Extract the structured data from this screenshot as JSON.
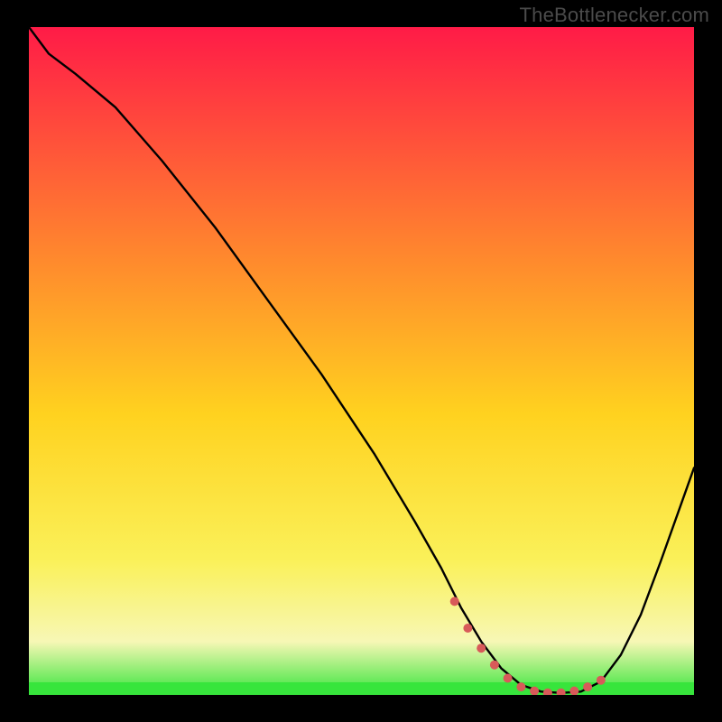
{
  "watermark": "TheBottlenecker.com",
  "colors": {
    "background": "#000000",
    "curve": "#000000",
    "marker": "#d85a59",
    "baseline": "#37e53c",
    "gradient_top": "#ff1b47",
    "gradient_mid_upper": "#ff8a2d",
    "gradient_mid": "#ffd21f",
    "gradient_mid_lower": "#faf15a",
    "gradient_low": "#f7f7b5",
    "gradient_bottom": "#37e53c"
  },
  "chart_data": {
    "type": "line",
    "title": "",
    "xlabel": "",
    "ylabel": "",
    "xlim": [
      0,
      100
    ],
    "ylim": [
      0,
      100
    ],
    "grid": false,
    "legend": false,
    "series": [
      {
        "name": "bottleneck-curve",
        "x": [
          0,
          3,
          7,
          13,
          20,
          28,
          36,
          44,
          52,
          58,
          62,
          65,
          68,
          71,
          74,
          77,
          80,
          83,
          86,
          89,
          92,
          95,
          100
        ],
        "y": [
          100,
          96,
          93,
          88,
          80,
          70,
          59,
          48,
          36,
          26,
          19,
          13,
          8,
          4,
          1.5,
          0.5,
          0.3,
          0.5,
          2,
          6,
          12,
          20,
          34
        ]
      }
    ],
    "markers": {
      "name": "highlighted-range",
      "x": [
        64,
        66,
        68,
        70,
        72,
        74,
        76,
        78,
        80,
        82,
        84,
        86
      ],
      "y": [
        14,
        10,
        7,
        4.5,
        2.5,
        1.2,
        0.6,
        0.3,
        0.3,
        0.6,
        1.2,
        2.2
      ]
    },
    "baseline_y": 0
  }
}
